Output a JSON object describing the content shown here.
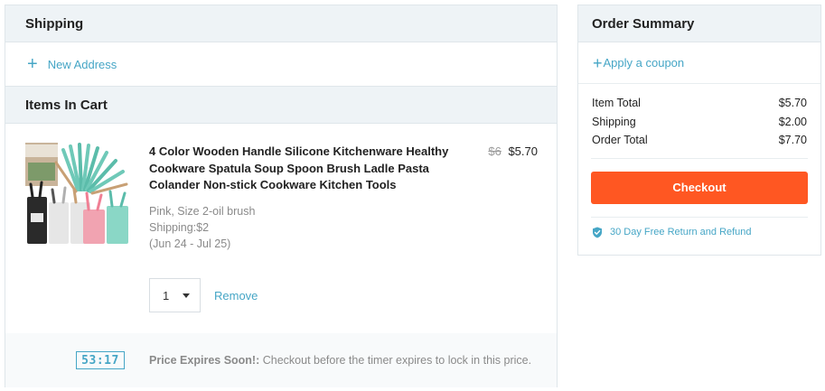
{
  "shipping": {
    "title": "Shipping",
    "new_address_label": "New Address"
  },
  "cart": {
    "title": "Items In Cart",
    "item": {
      "title": "4 Color Wooden Handle Silicone Kitchenware Healthy Cookware Spatula Soup Spoon Brush Ladle Pasta Colander Non-stick Cookware Kitchen Tools",
      "variant": "Pink, Size 2-oil brush",
      "shipping": "Shipping:$2",
      "delivery": "(Jun 24 - Jul 25)",
      "old_price": "$6",
      "price": "$5.70",
      "quantity": "1",
      "remove_label": "Remove",
      "image_icon": "product-thumbnail"
    },
    "timer": {
      "value": "53:17",
      "label_strong": "Price Expires Soon!:",
      "label": " Checkout before the timer expires to lock in this price."
    }
  },
  "summary": {
    "title": "Order Summary",
    "coupon_label": "Apply a coupon",
    "rows": [
      {
        "label": "Item Total",
        "value": "$5.70"
      },
      {
        "label": "Shipping",
        "value": "$2.00"
      },
      {
        "label": "Order Total",
        "value": "$7.70"
      }
    ],
    "checkout_label": "Checkout",
    "guarantee": "30 Day Free Return and Refund"
  },
  "colors": {
    "accent": "#46a6c6",
    "checkout": "#ff5722",
    "header_bg": "#eef3f6",
    "border": "#dfe6ea"
  }
}
